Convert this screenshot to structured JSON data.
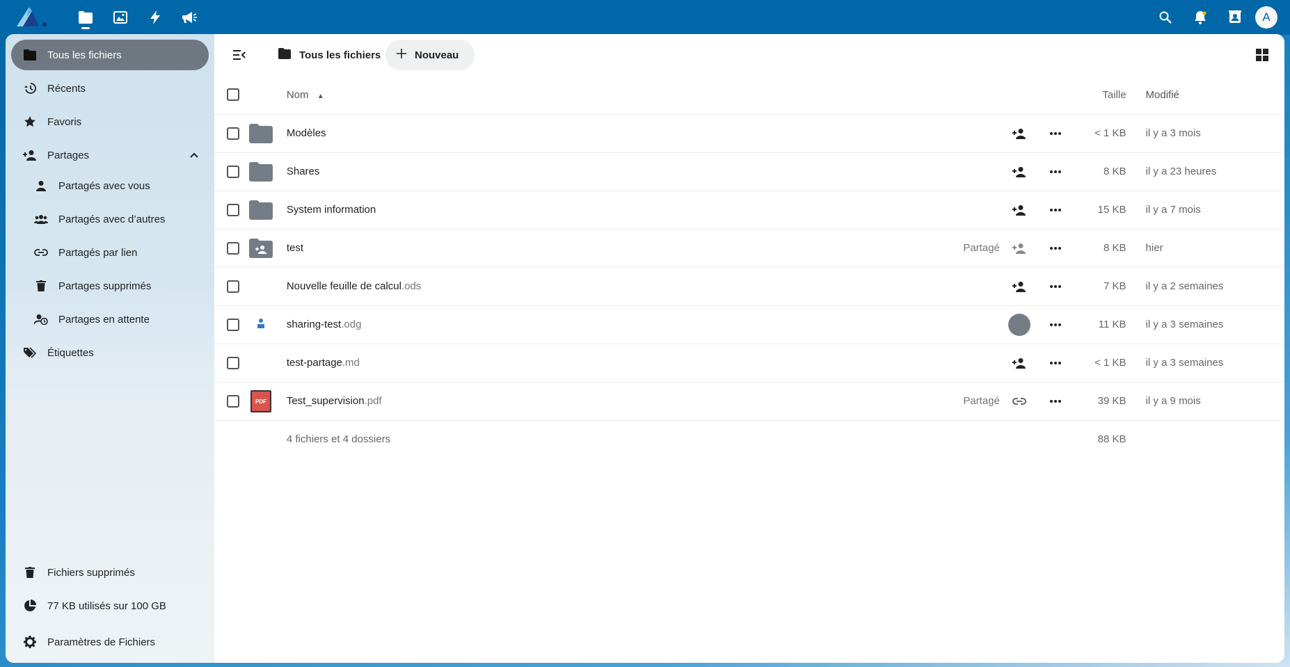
{
  "colors": {
    "header": "#0068a8",
    "active_nav": "#6f7780",
    "pdf": "#d9534f"
  },
  "header": {
    "apps": [
      {
        "icon": "files-icon",
        "name": "Files"
      },
      {
        "icon": "photos-icon",
        "name": "Photos"
      },
      {
        "icon": "activity-icon",
        "name": "Activity"
      },
      {
        "icon": "announcements-icon",
        "name": "Announcements"
      }
    ],
    "avatar_letter": "A"
  },
  "sidebar": {
    "items": [
      {
        "label": "Tous les fichiers",
        "icon": "folder-icon"
      },
      {
        "label": "Récents",
        "icon": "history-icon"
      },
      {
        "label": "Favoris",
        "icon": "star-icon"
      },
      {
        "label": "Partages",
        "icon": "share-icon"
      },
      {
        "label": "Partagés avec vous",
        "icon": "person-icon"
      },
      {
        "label": "Partagés avec d’autres",
        "icon": "group-icon"
      },
      {
        "label": "Partagés par lien",
        "icon": "link-icon"
      },
      {
        "label": "Partages supprimés",
        "icon": "trash-icon"
      },
      {
        "label": "Partages en attente",
        "icon": "pending-icon"
      },
      {
        "label": "Étiquettes",
        "icon": "tags-icon"
      }
    ],
    "bottom": {
      "trash": "Fichiers supprimés",
      "quota": "77 KB utilisés sur 100 GB",
      "settings": "Paramètres de Fichiers"
    }
  },
  "toolbar": {
    "breadcrumb": "Tous les fichiers",
    "new_label": "Nouveau"
  },
  "table": {
    "headers": {
      "name": "Nom",
      "size": "Taille",
      "modified": "Modifié"
    },
    "rows": [
      {
        "name": "Modèles",
        "ext": "",
        "type": "folder",
        "shared": "",
        "action": "share",
        "size": "< 1 KB",
        "modified": "il y a 3 mois"
      },
      {
        "name": "Shares",
        "ext": "",
        "type": "folder",
        "shared": "",
        "action": "share",
        "size": "8 KB",
        "modified": "il y a 23 heures"
      },
      {
        "name": "System information",
        "ext": "",
        "type": "folder",
        "shared": "",
        "action": "share",
        "size": "15 KB",
        "modified": "il y a 7 mois"
      },
      {
        "name": "test",
        "ext": "",
        "type": "shared-folder",
        "shared": "Partagé",
        "action": "share-grey",
        "size": "8 KB",
        "modified": "hier"
      },
      {
        "name": "Nouvelle feuille de calcul",
        "ext": ".ods",
        "type": "blank",
        "shared": "",
        "action": "share",
        "size": "7 KB",
        "modified": "il y a 2 semaines"
      },
      {
        "name": "sharing-test",
        "ext": ".odg",
        "type": "odg",
        "shared": "",
        "action": "avatar",
        "size": "11 KB",
        "modified": "il y a 3 semaines"
      },
      {
        "name": "test-partage",
        "ext": ".md",
        "type": "blank",
        "shared": "",
        "action": "share",
        "size": "< 1 KB",
        "modified": "il y a 3 semaines"
      },
      {
        "name": "Test_supervision",
        "ext": ".pdf",
        "type": "pdf",
        "shared": "Partagé",
        "action": "link",
        "size": "39 KB",
        "modified": "il y a 9 mois"
      }
    ],
    "summary": {
      "text": "4 fichiers et 4 dossiers",
      "size": "88 KB"
    }
  }
}
